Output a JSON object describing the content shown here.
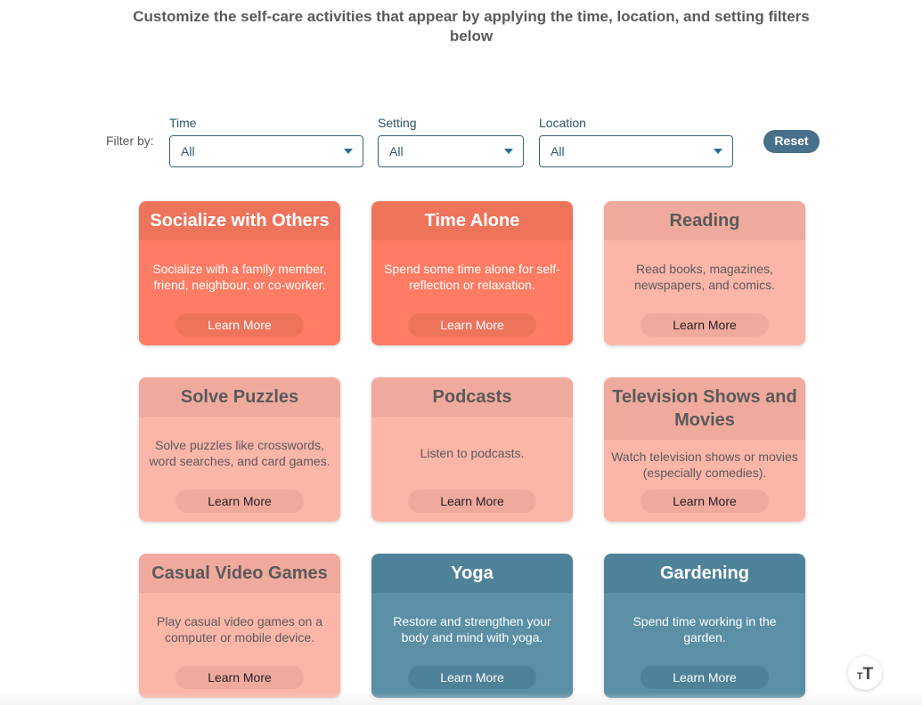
{
  "intro": "Customize the self-care activities that appear by applying the time, location, and setting filters below",
  "filters": {
    "label": "Filter by:",
    "time": {
      "label": "Time",
      "value": "All"
    },
    "setting": {
      "label": "Setting",
      "value": "All"
    },
    "location": {
      "label": "Location",
      "value": "All"
    },
    "reset_label": "Reset"
  },
  "colors": {
    "coral": "#fd7c63",
    "pink": "#fcb6a8",
    "teal": "#5a8fa6",
    "accent": "#47708a"
  },
  "cards": [
    {
      "title": "Socialize with Others",
      "desc": "Socialize with a family member, friend, neighbour, or co-worker.",
      "button": "Learn More"
    },
    {
      "title": "Time Alone",
      "desc": "Spend some time alone for self-reflection or relaxation.",
      "button": "Learn More"
    },
    {
      "title": "Reading",
      "desc": "Read books, magazines, newspapers, and comics.",
      "button": "Learn More"
    },
    {
      "title": "Solve Puzzles",
      "desc": "Solve puzzles like crosswords, word searches, and card games.",
      "button": "Learn More"
    },
    {
      "title": "Podcasts",
      "desc": "Listen to podcasts.",
      "button": "Learn More"
    },
    {
      "title": "Television Shows and Movies",
      "desc": "Watch television shows or movies (especially comedies).",
      "button": "Learn More"
    },
    {
      "title": "Casual Video Games",
      "desc": "Play casual video games on a computer or mobile device.",
      "button": "Learn More"
    },
    {
      "title": "Yoga",
      "desc": "Restore and strengthen your body and mind with yoga.",
      "button": "Learn More"
    },
    {
      "title": "Gardening",
      "desc": "Spend time working in the garden.",
      "button": "Learn More"
    }
  ],
  "text_size_button": {
    "small": "T",
    "large": "T"
  }
}
